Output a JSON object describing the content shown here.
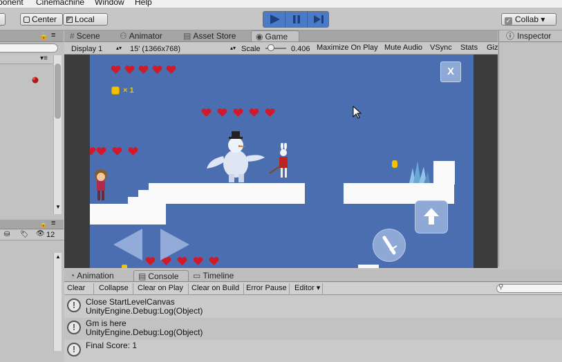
{
  "menubar": {
    "items": [
      "ponent",
      "Cinemachine",
      "Window",
      "Help"
    ]
  },
  "toolbar": {
    "pivot_label": "Center",
    "space_label": "Local",
    "collab_label": "Collab ▾"
  },
  "tabs": {
    "scene": "Scene",
    "animator": "Animator",
    "asset_store": "Asset Store",
    "game": "Game",
    "inspector": "Inspector"
  },
  "game_bar": {
    "display": "Display 1",
    "resolution": "15' (1366x768)",
    "scale_label": "Scale",
    "scale_value": "0.406",
    "maximize": "Maximize On Play",
    "mute": "Mute Audio",
    "vsync": "VSync",
    "stats": "Stats",
    "gizmos": "Giz"
  },
  "game": {
    "coins_text": "× 1",
    "close_label": "X"
  },
  "project_panel": {
    "count": "12"
  },
  "console": {
    "tab_animation": "Animation",
    "tab_console": "Console",
    "tab_timeline": "Timeline",
    "buttons": [
      "Clear",
      "Collapse",
      "Clear on Play",
      "Clear on Build",
      "Error Pause",
      "Editor ▾"
    ],
    "logs": [
      {
        "line1": "Close StartLevelCanvas",
        "line2": "UnityEngine.Debug:Log(Object)"
      },
      {
        "line1": "Gm is here",
        "line2": "UnityEngine.Debug:Log(Object)"
      },
      {
        "line1": "Final Score: 1",
        "line2": ""
      }
    ]
  },
  "colors": {
    "game_bg": "#4b6eb0",
    "heart": "#d01a2a",
    "play_accent": "#4a7bc8",
    "coin": "#f2c200"
  }
}
